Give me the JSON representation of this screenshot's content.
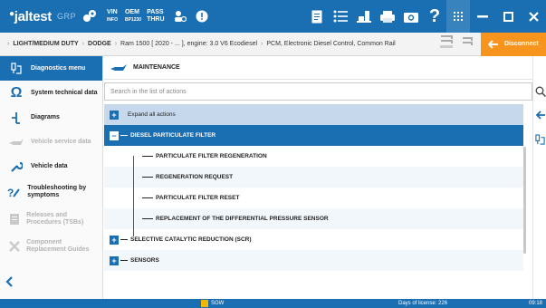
{
  "app": {
    "brand": "jaltest",
    "brand_sub": "GRP",
    "accent": "#1a6fb3",
    "orange": "#f7941d"
  },
  "toolbar": {
    "vin_label": "VIN",
    "vin_sub": "INFO",
    "oem_label": "OEM",
    "oem_sub": "BP1230",
    "pass_label": "PASS",
    "pass_sub": "THRU"
  },
  "breadcrumb": {
    "items": [
      "LIGHT/MEDIUM DUTY",
      "DODGE",
      "Ram 1500 [ 2020 - ... ], engine: 3.0 V6 Ecodiesel",
      "PCM, Electronic Diesel Control, Common Rail"
    ],
    "disconnect_label": "Disconnect"
  },
  "sidebar": {
    "items": [
      {
        "label": "Diagnostics menu",
        "icon": "diagnostics-icon"
      },
      {
        "label": "System technical data",
        "icon": "omega-icon"
      },
      {
        "label": "Diagrams",
        "icon": "diagram-icon"
      },
      {
        "label": "Vehicle service data",
        "icon": "oil-can-icon"
      },
      {
        "label": "Vehicle data",
        "icon": "wrench-icon"
      },
      {
        "label": "Troubleshooting by symptoms",
        "icon": "troubleshooting-icon"
      },
      {
        "label": "Releases and Procedures (TSBs)",
        "icon": "document-icon"
      },
      {
        "label": "Component Replacement Guides",
        "icon": "tools-icon"
      }
    ]
  },
  "main": {
    "title": "MAINTENANCE",
    "search_placeholder": "Search in the list of actions",
    "expand_all": "Expand all actions",
    "tree": {
      "category1": "DIESEL PARTICULATE FILTER",
      "children": [
        "PARTICULATE FILTER REGENERATION",
        "REGENERATION REQUEST",
        "PARTICULATE FILTER RESET",
        "REPLACEMENT OF THE DIFFERENTIAL PRESSURE SENSOR"
      ],
      "category2": "SELECTIVE CATALYTIC REDUCTION (SCR)",
      "category3": "SENSORS"
    }
  },
  "status": {
    "sgw": "SGW",
    "license": "Days of license: 226",
    "time": "09:18"
  }
}
